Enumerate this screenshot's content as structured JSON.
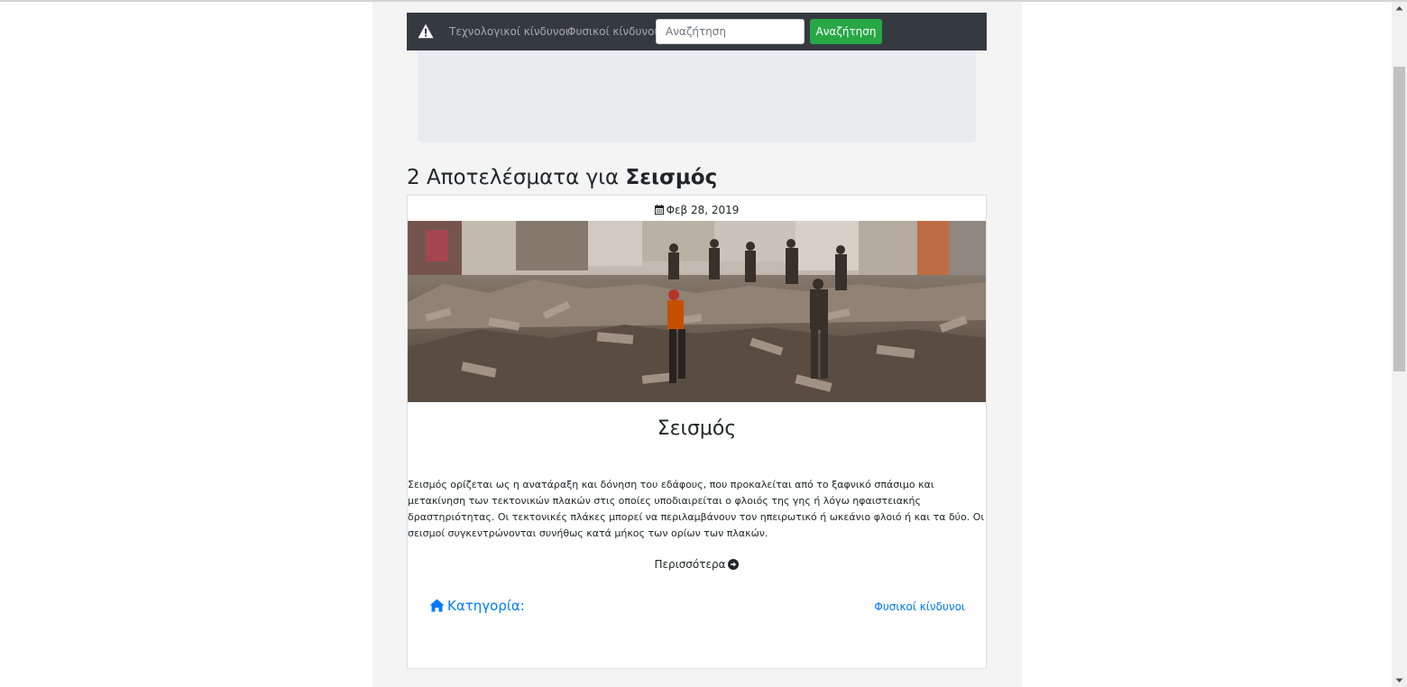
{
  "nav": {
    "brand_icon": "warning-triangle-icon",
    "links": [
      "Τεχνολογικοί κίνδυνοι",
      "Φυσικοί κίνδυνοι"
    ],
    "search_placeholder": "Αναζήτηση",
    "search_button": "Αναζήτηση"
  },
  "results": {
    "prefix": "2 Αποτελέσματα για ",
    "query": "Σεισμός"
  },
  "card": {
    "date": "Φεβ 28, 2019",
    "image_alt": "earthquake rubble",
    "title": "Σεισμός",
    "text": "Σεισμός ορίζεται ως η ανατάραξη και δόνηση του εδάφους, που προκαλείται από το ξαφνικό σπάσιμο και μετακίνηση των τεκτονικών πλακών στις οποίες υποδιαιρείται ο φλοιός της γης ή λόγω ηφαιστειακής δραστηριότητας. Οι τεκτονικές πλάκες μπορεί να περιλαμβάνουν τον ηπειρωτικό ή ωκεάνιο φλοιό ή και τα δύο. Οι σεισμοί συγκεντρώνονται συνήθως κατά μήκος των ορίων των πλακών.",
    "more": "Περισσότερα",
    "category_label": "Κατηγορία:",
    "category_value": "Φυσικοί κίνδυνοι"
  },
  "colors": {
    "navbar": "#343a40",
    "accent_green": "#28a745",
    "link_blue": "#007bff"
  }
}
